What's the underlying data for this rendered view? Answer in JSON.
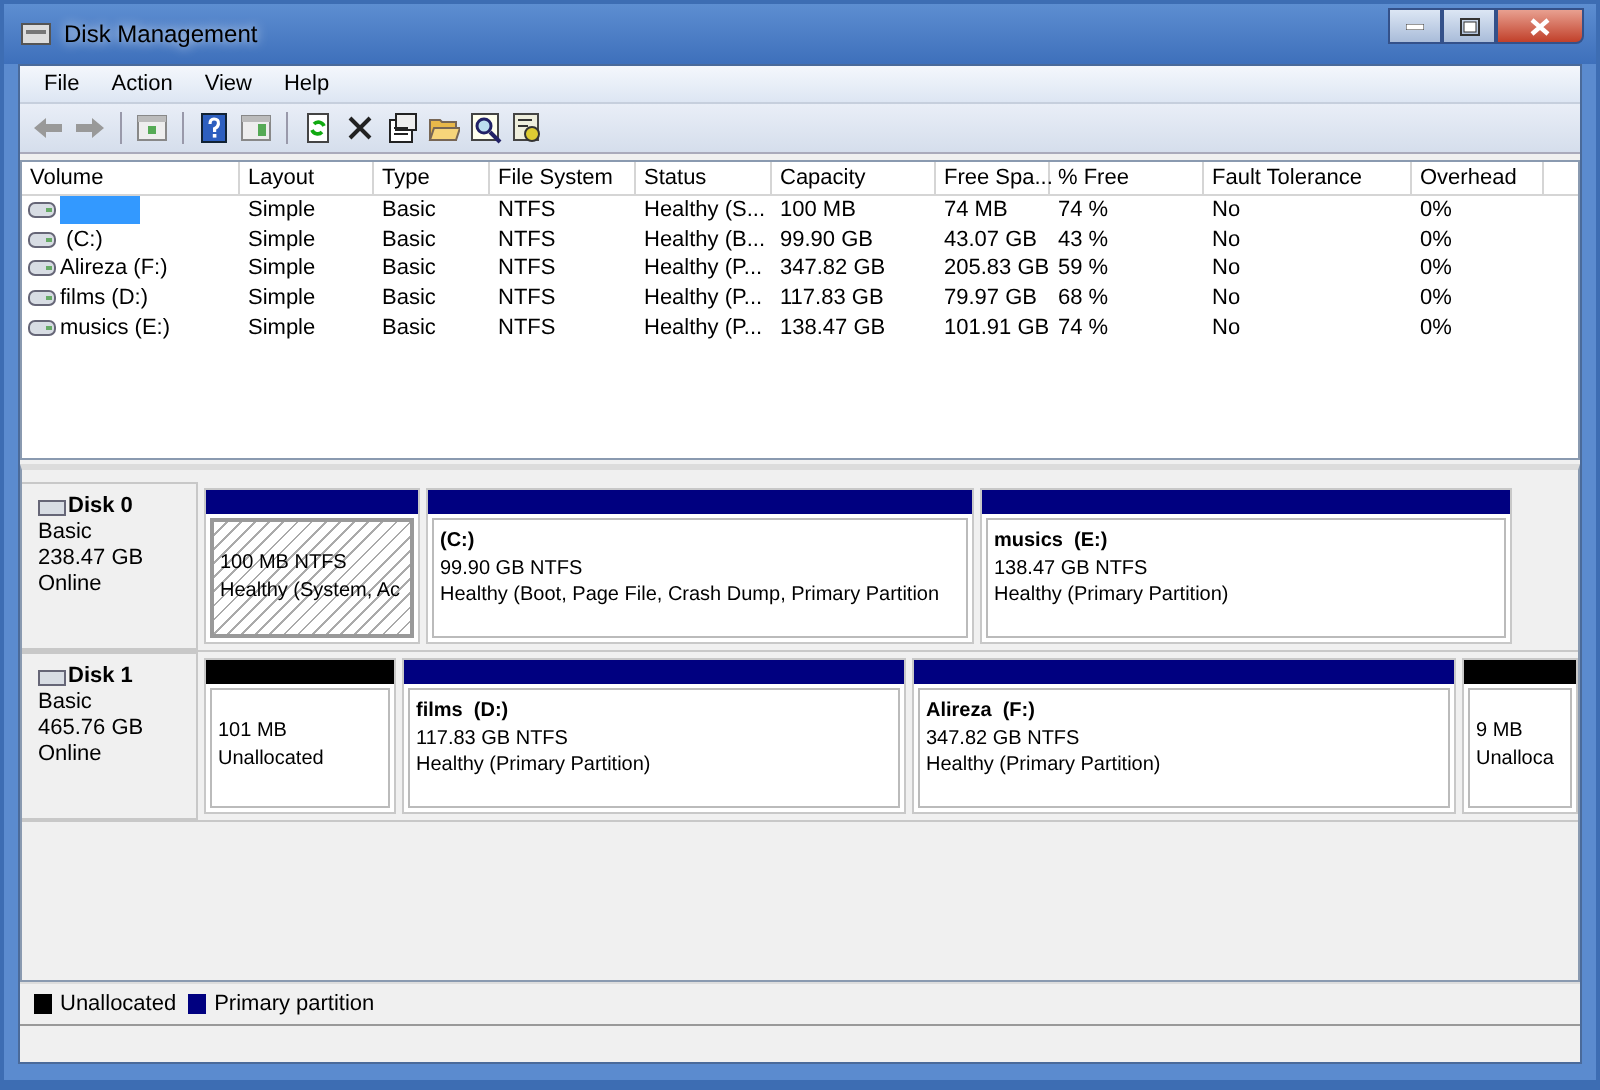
{
  "window": {
    "title": "Disk Management"
  },
  "menu": [
    "File",
    "Action",
    "View",
    "Help"
  ],
  "table": {
    "columns": [
      "Volume",
      "Layout",
      "Type",
      "File System",
      "Status",
      "Capacity",
      "Free Spa...",
      "% Free",
      "Fault Tolerance",
      "Overhead"
    ],
    "rows": [
      {
        "selected": true,
        "cells": [
          "",
          "Simple",
          "Basic",
          "NTFS",
          "Healthy (S...",
          "100 MB",
          "74 MB",
          "74 %",
          "No",
          "0%"
        ]
      },
      {
        "selected": false,
        "cells": [
          " (C:)",
          "Simple",
          "Basic",
          "NTFS",
          "Healthy (B...",
          "99.90 GB",
          "43.07 GB",
          "43 %",
          "No",
          "0%"
        ]
      },
      {
        "selected": false,
        "cells": [
          "Alireza (F:)",
          "Simple",
          "Basic",
          "NTFS",
          "Healthy (P...",
          "347.82 GB",
          "205.83 GB",
          "59 %",
          "No",
          "0%"
        ]
      },
      {
        "selected": false,
        "cells": [
          "films (D:)",
          "Simple",
          "Basic",
          "NTFS",
          "Healthy (P...",
          "117.83 GB",
          "79.97 GB",
          "68 %",
          "No",
          "0%"
        ]
      },
      {
        "selected": false,
        "cells": [
          "musics (E:)",
          "Simple",
          "Basic",
          "NTFS",
          "Healthy (P...",
          "138.47 GB",
          "101.91 GB",
          "74 %",
          "No",
          "0%"
        ]
      }
    ]
  },
  "disks": [
    {
      "name": "Disk 0",
      "type": "Basic",
      "size": "238.47 GB",
      "state": "Online",
      "partitions": [
        {
          "kind": "primary",
          "selected": true,
          "size": "100 MB NTFS",
          "status": "Healthy (System, Ac"
        },
        {
          "kind": "primary",
          "selected": false,
          "name": "(C:)",
          "size": "99.90 GB NTFS",
          "status": "Healthy (Boot, Page File, Crash Dump, Primary Partition"
        },
        {
          "kind": "primary",
          "selected": false,
          "name": "musics  (E:)",
          "size": "138.47 GB NTFS",
          "status": "Healthy (Primary Partition)"
        }
      ]
    },
    {
      "name": "Disk 1",
      "type": "Basic",
      "size": "465.76 GB",
      "state": "Online",
      "partitions": [
        {
          "kind": "unallocated",
          "selected": false,
          "size": "101 MB",
          "status": "Unallocated"
        },
        {
          "kind": "primary",
          "selected": false,
          "name": "films  (D:)",
          "size": "117.83 GB NTFS",
          "status": "Healthy (Primary Partition)"
        },
        {
          "kind": "primary",
          "selected": false,
          "name": "Alireza  (F:)",
          "size": "347.82 GB NTFS",
          "status": "Healthy (Primary Partition)"
        },
        {
          "kind": "unallocated",
          "selected": false,
          "size": "9 MB",
          "status": "Unalloca"
        }
      ]
    }
  ],
  "legend": [
    {
      "kind": "unallocated",
      "label": "Unallocated"
    },
    {
      "kind": "primary",
      "label": "Primary partition"
    }
  ]
}
